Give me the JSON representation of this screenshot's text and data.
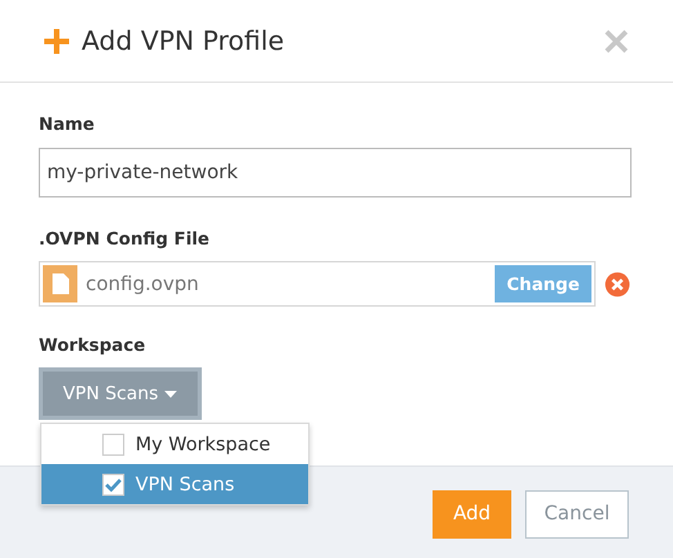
{
  "dialog": {
    "title": "Add VPN Profile"
  },
  "name_field": {
    "label": "Name",
    "value": "my-private-network"
  },
  "config_file": {
    "label": ".OVPN Config File",
    "filename": "config.ovpn",
    "change_button": "Change"
  },
  "workspace": {
    "label": "Workspace",
    "button": "VPN Scans",
    "expanded": true,
    "options": [
      {
        "label": "My Workspace",
        "selected": false
      },
      {
        "label": "VPN Scans",
        "selected": true
      }
    ]
  },
  "buttons": {
    "primary": "Add",
    "secondary": "Cancel"
  }
}
